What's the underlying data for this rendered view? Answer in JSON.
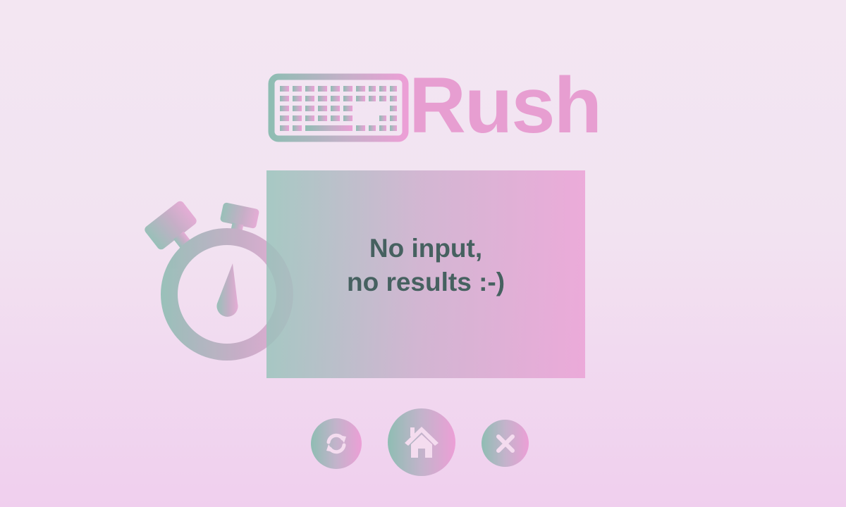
{
  "logo": {
    "icon": "keyboard-icon",
    "text": "Rush",
    "text_color": "#e79ed1"
  },
  "result": {
    "line1": "No input,",
    "line2": "no results :-)",
    "text_color": "#466160"
  },
  "decoration": {
    "icon": "stopwatch-icon"
  },
  "actions": [
    {
      "name": "refresh",
      "icon": "refresh-icon"
    },
    {
      "name": "home",
      "icon": "home-icon"
    },
    {
      "name": "close",
      "icon": "close-icon"
    }
  ],
  "colors": {
    "gradient_start": "#8fbdb3",
    "gradient_end": "#ec9fd6"
  }
}
